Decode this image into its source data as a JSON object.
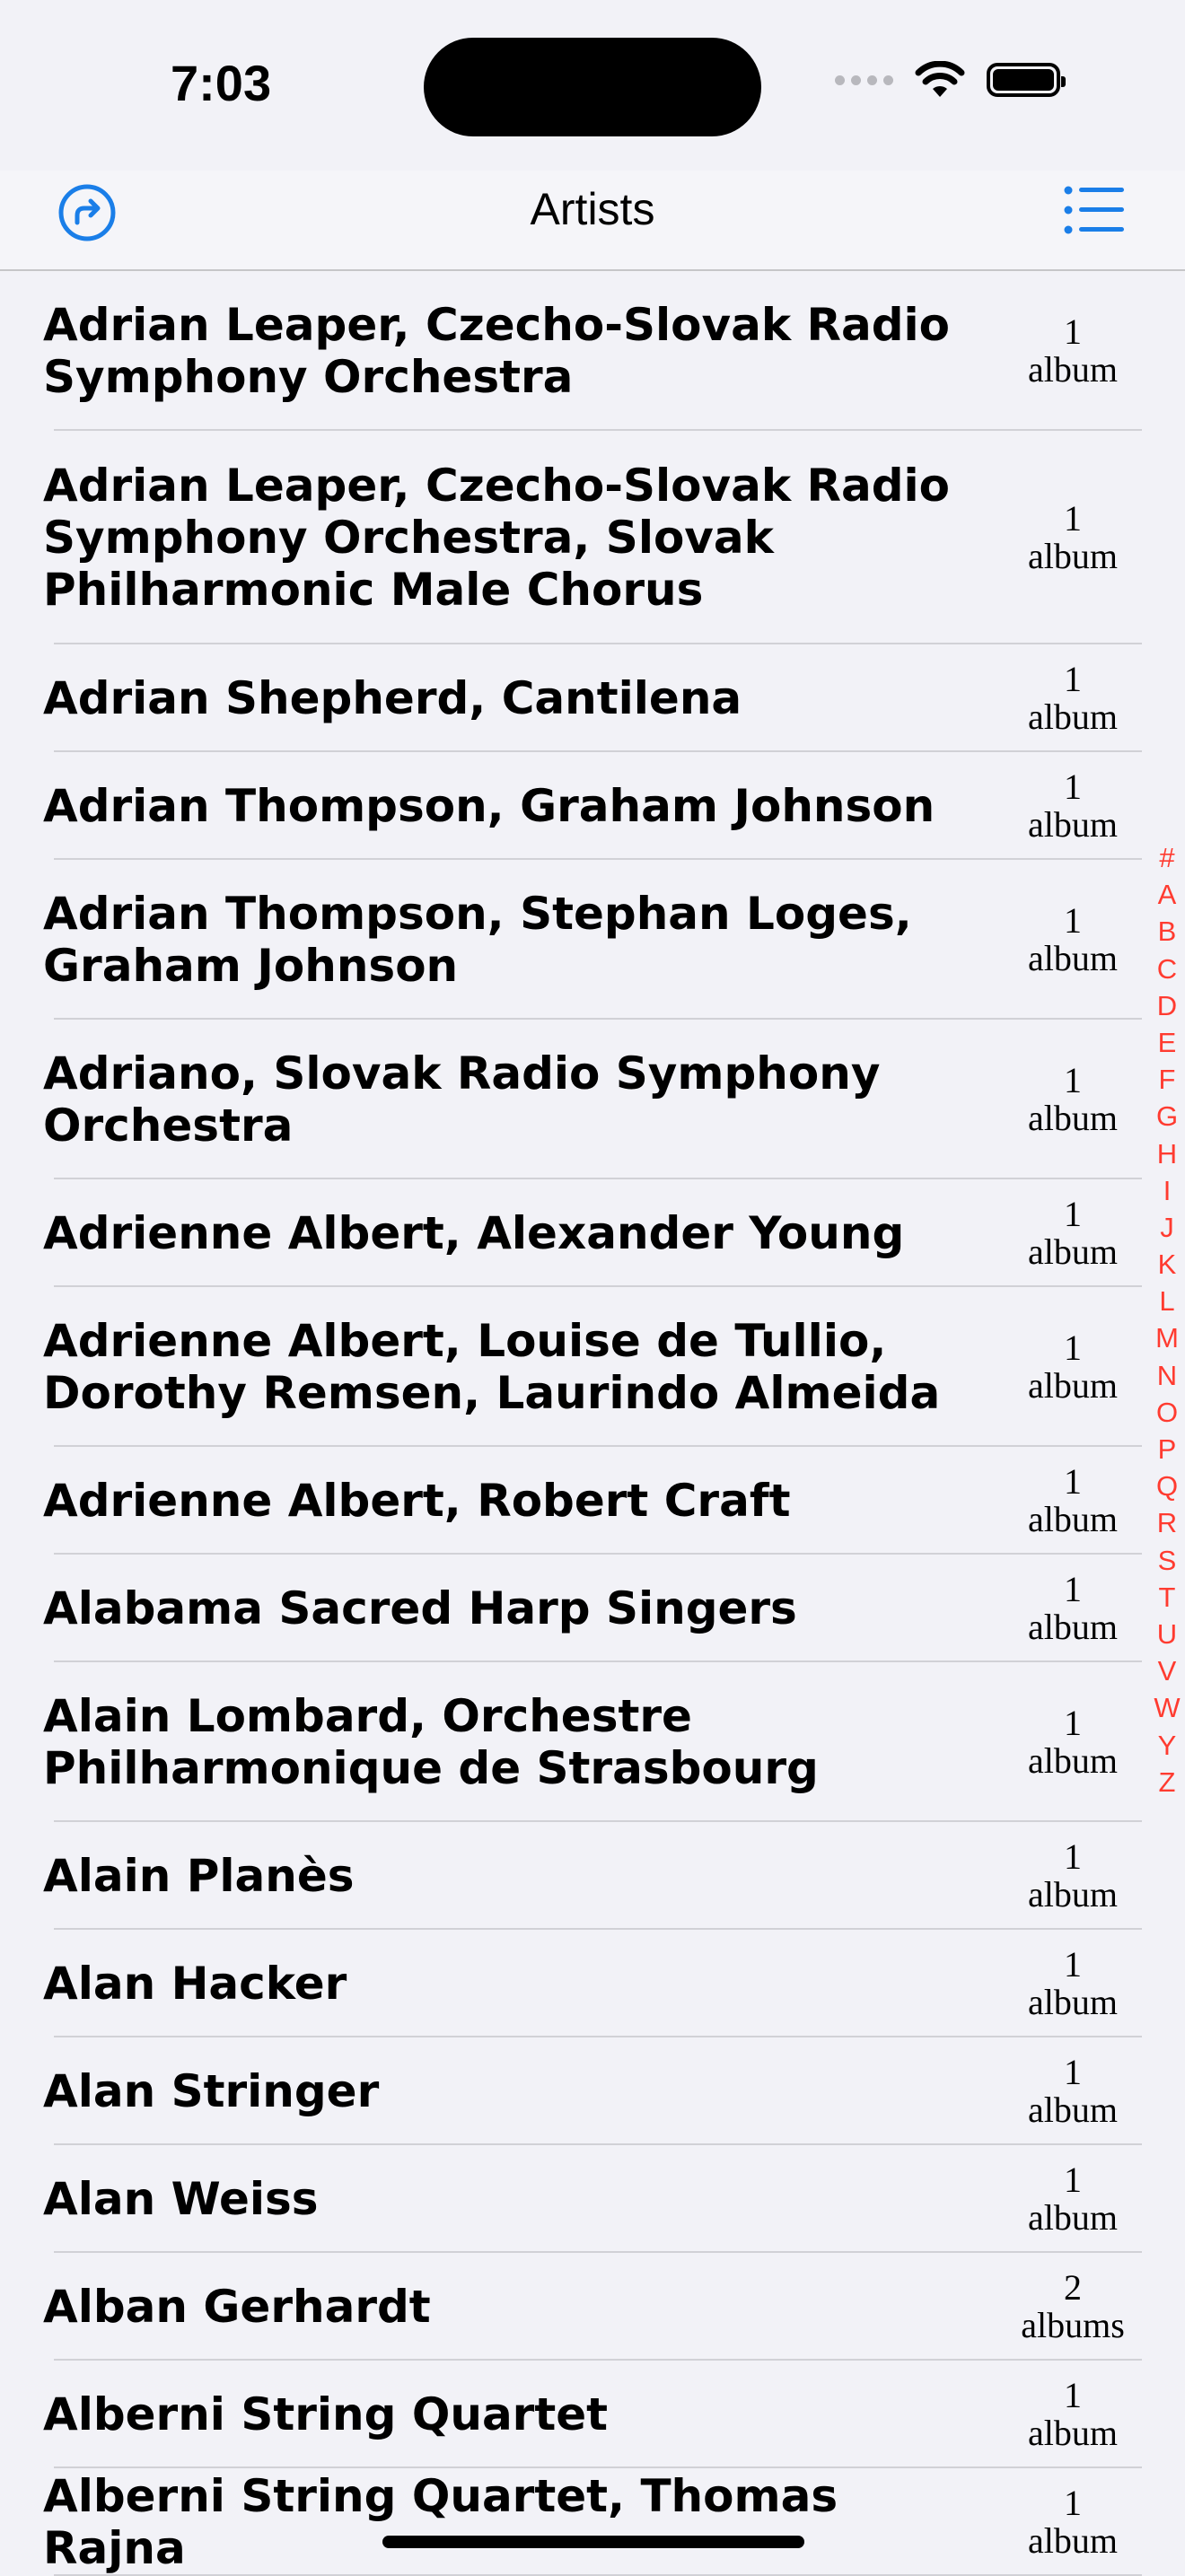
{
  "status": {
    "time": "7:03"
  },
  "nav": {
    "title": "Artists",
    "left_icon": "share-arrow-icon",
    "right_icon": "list-icon",
    "accent": "#1a7ee8"
  },
  "artists": [
    {
      "name": "Adrian Leaper, Czecho-Slovak Radio Symphony Orchestra",
      "count": "1",
      "unit": "album"
    },
    {
      "name": "Adrian Leaper, Czecho-Slovak Radio Symphony Orchestra, Slovak Philharmonic Male Chorus",
      "count": "1",
      "unit": "album"
    },
    {
      "name": "Adrian Shepherd, Cantilena",
      "count": "1",
      "unit": "album"
    },
    {
      "name": "Adrian Thompson, Graham Johnson",
      "count": "1",
      "unit": "album"
    },
    {
      "name": "Adrian Thompson, Stephan Loges, Graham Johnson",
      "count": "1",
      "unit": "album"
    },
    {
      "name": "Adriano, Slovak Radio Symphony Orchestra",
      "count": "1",
      "unit": "album"
    },
    {
      "name": "Adrienne Albert, Alexander Young",
      "count": "1",
      "unit": "album"
    },
    {
      "name": "Adrienne Albert, Louise de Tullio, Dorothy Remsen, Laurindo Almeida",
      "count": "1",
      "unit": "album"
    },
    {
      "name": "Adrienne Albert, Robert Craft",
      "count": "1",
      "unit": "album"
    },
    {
      "name": "Alabama Sacred Harp Singers",
      "count": "1",
      "unit": "album"
    },
    {
      "name": "Alain Lombard, Orchestre Philharmonique de Strasbourg",
      "count": "1",
      "unit": "album"
    },
    {
      "name": "Alain Planès",
      "count": "1",
      "unit": "album"
    },
    {
      "name": "Alan Hacker",
      "count": "1",
      "unit": "album"
    },
    {
      "name": "Alan Stringer",
      "count": "1",
      "unit": "album"
    },
    {
      "name": "Alan Weiss",
      "count": "1",
      "unit": "album"
    },
    {
      "name": "Alban Gerhardt",
      "count": "2",
      "unit": "albums"
    },
    {
      "name": "Alberni String Quartet",
      "count": "1",
      "unit": "album"
    },
    {
      "name": "Alberni String Quartet, Thomas Rajna",
      "count": "1",
      "unit": "album"
    }
  ],
  "index_letters": [
    "#",
    "A",
    "B",
    "C",
    "D",
    "E",
    "F",
    "G",
    "H",
    "I",
    "J",
    "K",
    "L",
    "M",
    "N",
    "O",
    "P",
    "Q",
    "R",
    "S",
    "T",
    "U",
    "V",
    "W",
    "Y",
    "Z"
  ],
  "index_color": "#ff3b30"
}
